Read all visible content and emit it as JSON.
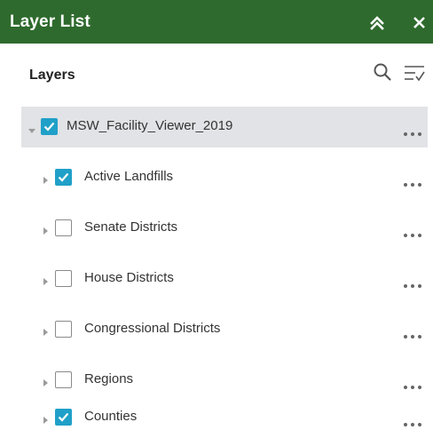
{
  "panel": {
    "title": "Layer List",
    "collapse_icon": "double-chevron-up-icon",
    "close_label": "✕"
  },
  "header": {
    "layers_label": "Layers",
    "search_icon": "search-icon",
    "filter_icon": "filter-icon"
  },
  "colors": {
    "title_bar": "#2e6a2d",
    "checkbox_on": "#20a0c8",
    "root_row": "#e1e3e6"
  },
  "root_layer": {
    "label": "MSW_Facility_Viewer_2019",
    "checked": true,
    "expanded": true
  },
  "layers": [
    {
      "label": "Active Landfills",
      "checked": true
    },
    {
      "label": "Senate Districts",
      "checked": false
    },
    {
      "label": "House Districts",
      "checked": false
    },
    {
      "label": "Congressional Districts",
      "checked": false
    },
    {
      "label": "Regions",
      "checked": false
    },
    {
      "label": "Counties",
      "checked": true
    }
  ]
}
